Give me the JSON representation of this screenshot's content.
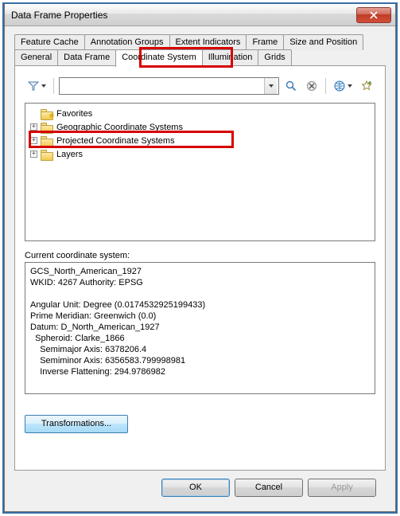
{
  "title": "Data Frame Properties",
  "tabs_row1": [
    "Feature Cache",
    "Annotation Groups",
    "Extent Indicators",
    "Frame",
    "Size and Position"
  ],
  "tabs_row2": [
    "General",
    "Data Frame",
    "Coordinate System",
    "Illumination",
    "Grids"
  ],
  "active_tab": "Coordinate System",
  "search": {
    "value": ""
  },
  "tree": {
    "items": [
      {
        "label": "Favorites",
        "expandable": false,
        "fav": true
      },
      {
        "label": "Geographic Coordinate Systems",
        "expandable": true
      },
      {
        "label": "Projected Coordinate Systems",
        "expandable": true,
        "highlighted": true
      },
      {
        "label": "Layers",
        "expandable": true
      }
    ]
  },
  "section_label": "Current coordinate system:",
  "details": "GCS_North_American_1927\nWKID: 4267 Authority: EPSG\n\nAngular Unit: Degree (0.0174532925199433)\nPrime Meridian: Greenwich (0.0)\nDatum: D_North_American_1927\n  Spheroid: Clarke_1866\n    Semimajor Axis: 6378206.4\n    Semiminor Axis: 6356583.799998981\n    Inverse Flattening: 294.9786982",
  "transformations_label": "Transformations...",
  "buttons": {
    "ok": "OK",
    "cancel": "Cancel",
    "apply": "Apply"
  }
}
